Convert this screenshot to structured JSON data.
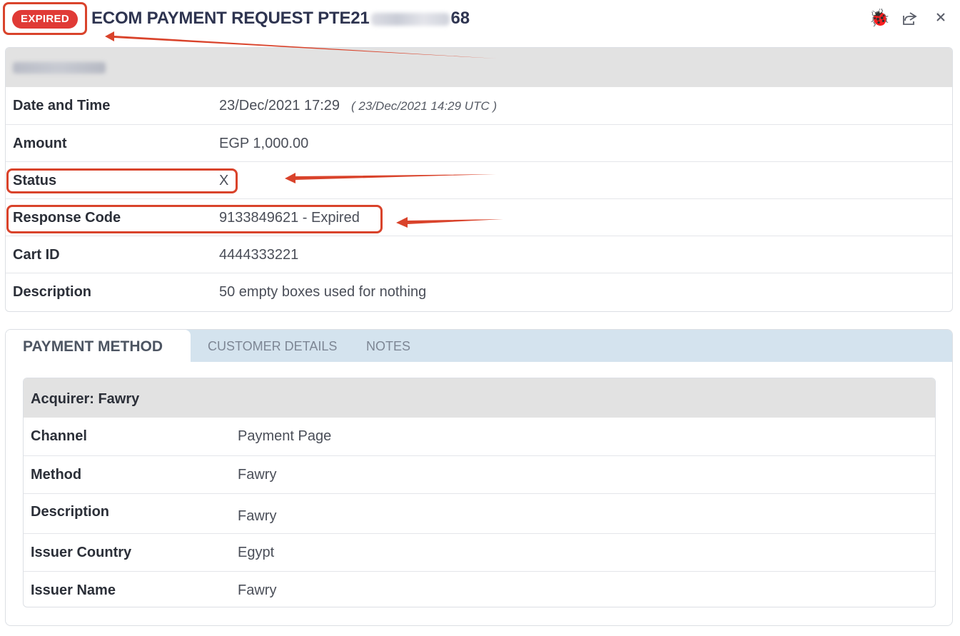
{
  "header": {
    "status_badge": "EXPIRED",
    "title_prefix": "ECOM PAYMENT REQUEST  PTE21",
    "title_suffix": "68",
    "icons": [
      "bug-icon",
      "share-icon",
      "close-icon"
    ]
  },
  "details": {
    "rows": [
      {
        "label": "Date and Time",
        "value": "23/Dec/2021 17:29",
        "extra": "( 23/Dec/2021 14:29 UTC )"
      },
      {
        "label": "Amount",
        "value": "EGP 1,000.00"
      },
      {
        "label": "Status",
        "value": "X"
      },
      {
        "label": "Response Code",
        "value": "9133849621 - Expired"
      },
      {
        "label": "Cart ID",
        "value": "4444333221"
      },
      {
        "label": "Description",
        "value": "50 empty boxes used for nothing"
      }
    ]
  },
  "tabs": [
    {
      "label": "PAYMENT METHOD",
      "active": true
    },
    {
      "label": "CUSTOMER DETAILS",
      "active": false
    },
    {
      "label": "NOTES",
      "active": false
    }
  ],
  "payment_method": {
    "acquirer": "Acquirer: Fawry",
    "rows": [
      {
        "label": "Channel",
        "value": "Payment Page"
      },
      {
        "label": "Method",
        "value": "Fawry"
      },
      {
        "label": "Description",
        "value": "Fawry"
      },
      {
        "label": "Issuer Country",
        "value": "Egypt"
      },
      {
        "label": "Issuer Name",
        "value": "Fawry"
      }
    ]
  },
  "colors": {
    "badge": "#e03a36",
    "annotation": "#d9432b",
    "tab_bar": "#d4e3ee",
    "title": "#2e3450"
  }
}
